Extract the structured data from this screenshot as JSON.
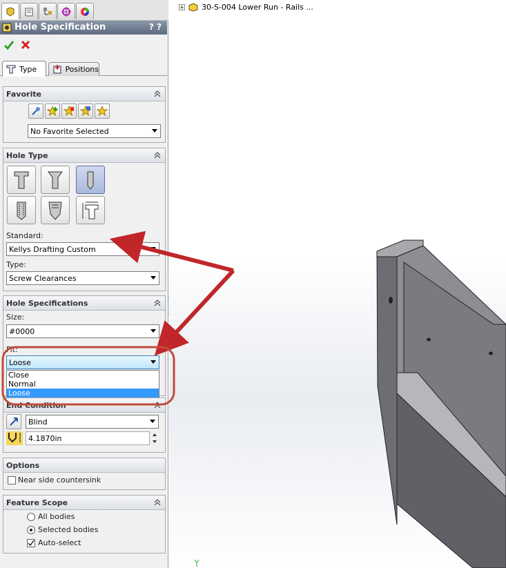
{
  "panel": {
    "title": "Hole Specification",
    "help": "?",
    "tabs": [
      {
        "label": "Type",
        "selected": true
      },
      {
        "label": "Positions",
        "selected": false
      }
    ],
    "favorite": {
      "header": "Favorite",
      "selected": "No Favorite Selected"
    },
    "hole_type": {
      "header": "Hole Type",
      "standard_label": "Standard:",
      "standard_value": "Kellys Drafting Custom",
      "type_label": "Type:",
      "type_value": "Screw Clearances"
    },
    "hole_specs": {
      "header": "Hole Specifications",
      "size_label": "Size:",
      "size_value": "#0000",
      "fit_label": "Fit:",
      "fit_value": "Loose",
      "fit_options": [
        "Close",
        "Normal",
        "Loose"
      ]
    },
    "end_condition": {
      "header": "End Condition",
      "value": "Blind",
      "depth": "4.1870in"
    },
    "options": {
      "header": "Options",
      "near_side_countersink": "Near side countersink"
    },
    "feature_scope": {
      "header": "Feature Scope",
      "all_bodies": "All bodies",
      "selected_bodies": "Selected bodies",
      "auto_select": "Auto-select"
    }
  },
  "viewport": {
    "tree_item": "30-S-004 Lower Run - Rails ..."
  },
  "colors": {
    "annotation_arrow": "#c0262a",
    "annotation_circle": "#c24a3a",
    "title_bar": "#5d6b80",
    "highlight": "#3399ff"
  }
}
